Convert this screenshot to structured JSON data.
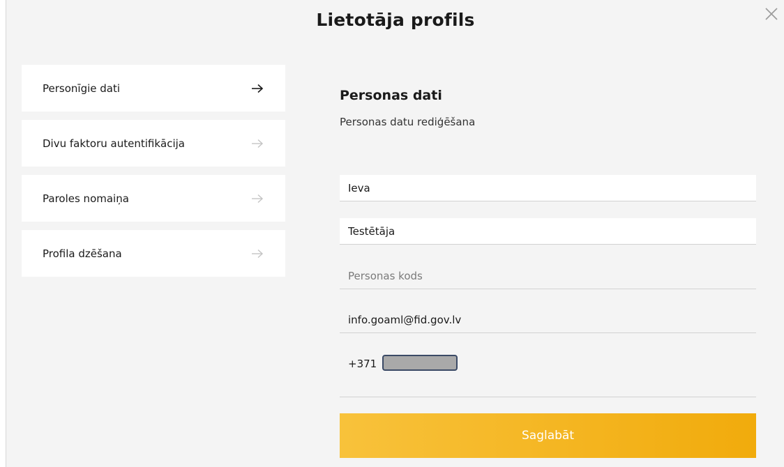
{
  "modal": {
    "title": "Lietotāja profils"
  },
  "nav": {
    "items": [
      {
        "label": "Personīgie dati",
        "active": true
      },
      {
        "label": "Divu faktoru autentifikācija",
        "active": false
      },
      {
        "label": "Paroles nomaiņa",
        "active": false
      },
      {
        "label": "Profila dzēšana",
        "active": false
      }
    ]
  },
  "content": {
    "title": "Personas dati",
    "subtitle": "Personas datu rediģēšana"
  },
  "form": {
    "first_name": "Ieva",
    "last_name": "Testētāja",
    "personal_code_placeholder": "Personas kods",
    "email": "info.goaml@fid.gov.lv",
    "phone_prefix": "+371"
  },
  "actions": {
    "save_label": "Saglabāt"
  },
  "colors": {
    "background": "#f4f4f4",
    "accent_start": "#f8c23b",
    "accent_end": "#f1ab0c",
    "arrow_active": "#1a1a1a",
    "arrow_inactive": "#c4c4c4"
  }
}
